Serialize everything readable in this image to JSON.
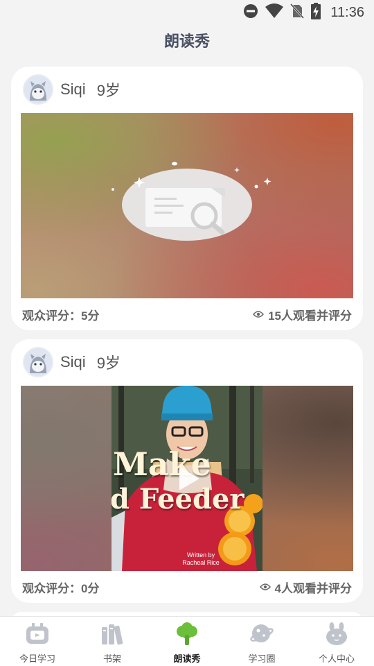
{
  "status_bar": {
    "time": "11:36"
  },
  "page": {
    "title": "朗读秀"
  },
  "posts": [
    {
      "user_name": "Siqi",
      "age": "9岁",
      "rating_label": "观众评分：5分",
      "views_label": "15人观看并评分"
    },
    {
      "user_name": "Siqi",
      "age": "9岁",
      "rating_label": "观众评分：0分",
      "views_label": "4人观看并评分",
      "thumbnail": {
        "line1": "Make",
        "line2": "d Feeder",
        "credit_line1": "Written by",
        "credit_line2": "Racheal Rice"
      }
    }
  ],
  "tabs": [
    {
      "label": "今日学习",
      "icon": "tv-icon",
      "active": false
    },
    {
      "label": "书架",
      "icon": "books-icon",
      "active": false
    },
    {
      "label": "朗读秀",
      "icon": "tree-icon",
      "active": true
    },
    {
      "label": "学习圈",
      "icon": "planet-icon",
      "active": false
    },
    {
      "label": "个人中心",
      "icon": "bunny-icon",
      "active": false
    }
  ],
  "colors": {
    "accent": "#6cbf3a",
    "inactive_icon": "#bfc3cc",
    "title": "#4a5064"
  }
}
